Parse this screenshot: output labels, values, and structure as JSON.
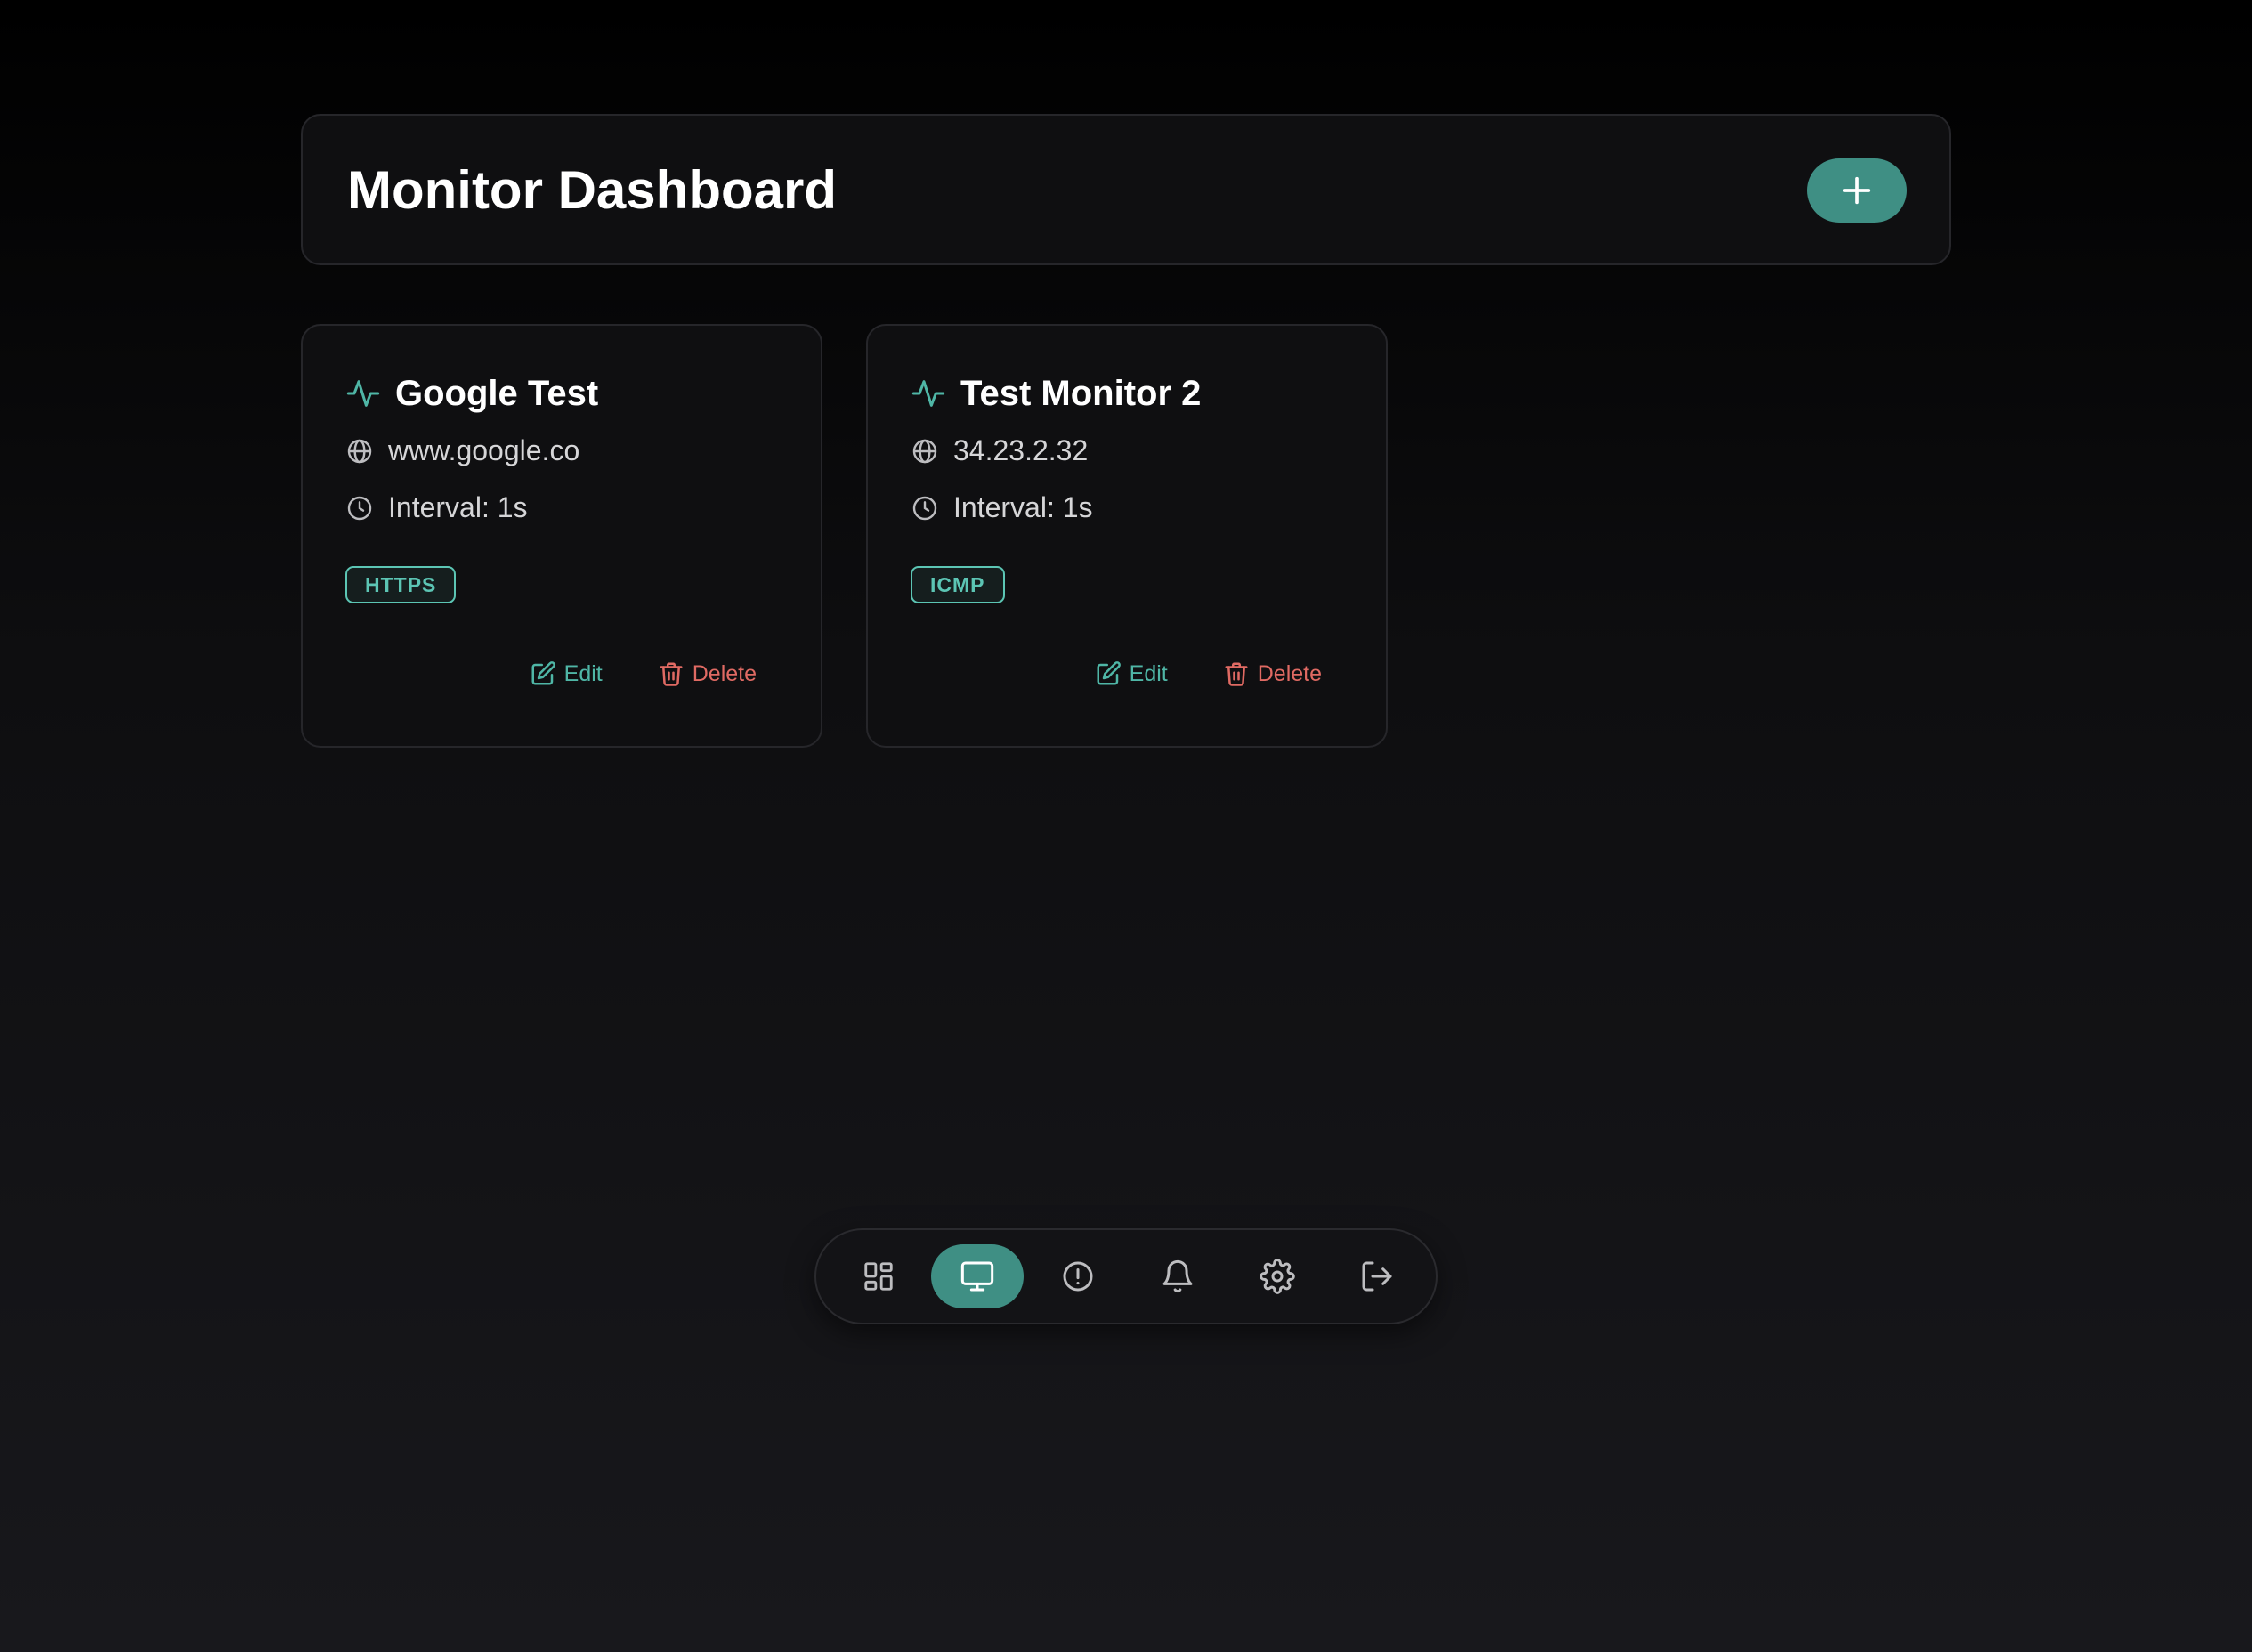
{
  "header": {
    "title": "Monitor Dashboard",
    "add_icon": "plus-icon"
  },
  "monitors": [
    {
      "name": "Google Test",
      "target": "www.google.co",
      "interval": "Interval: 1s",
      "protocol": "HTTPS",
      "edit_label": "Edit",
      "delete_label": "Delete"
    },
    {
      "name": "Test Monitor 2",
      "target": "34.23.2.32",
      "interval": "Interval: 1s",
      "protocol": "ICMP",
      "edit_label": "Edit",
      "delete_label": "Delete"
    }
  ],
  "nav": {
    "items": [
      {
        "icon": "dashboard-grid-icon",
        "active": false
      },
      {
        "icon": "monitor-icon",
        "active": true
      },
      {
        "icon": "alert-circle-icon",
        "active": false
      },
      {
        "icon": "bell-icon",
        "active": false
      },
      {
        "icon": "settings-gear-icon",
        "active": false
      },
      {
        "icon": "logout-icon",
        "active": false
      }
    ]
  },
  "colors": {
    "accent": "#3f8f84",
    "accent_text": "#4fb6a6",
    "danger": "#e06a63",
    "card_bg": "#0f0f11",
    "border": "#26262a"
  }
}
